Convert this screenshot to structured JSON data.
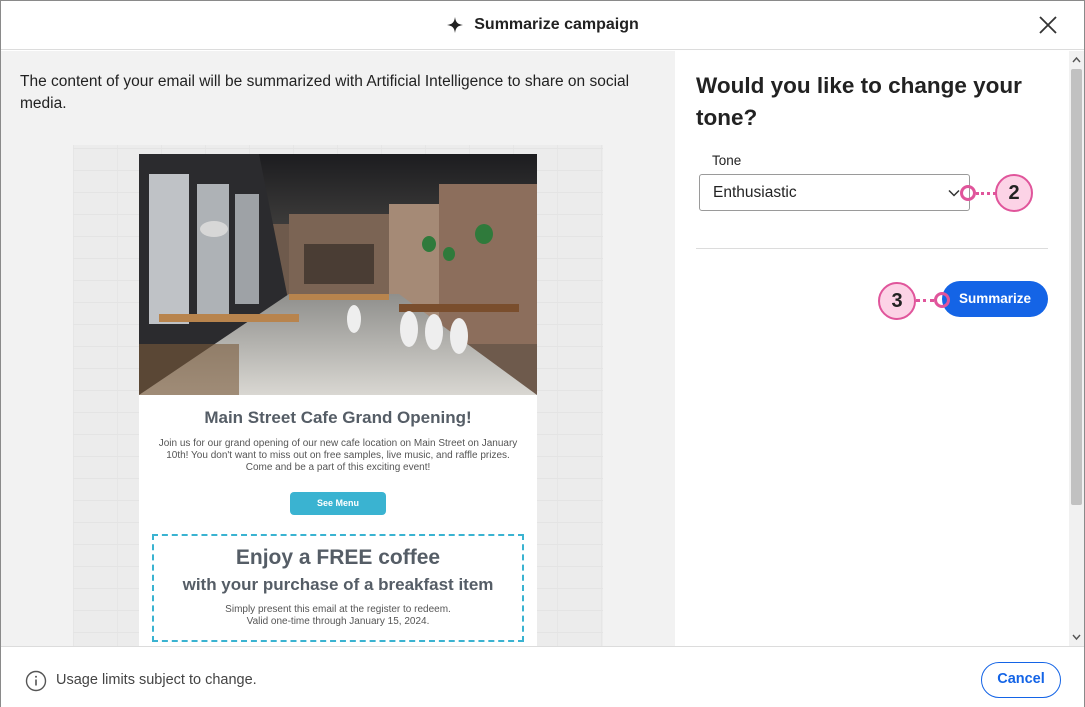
{
  "header": {
    "title": "Summarize campaign",
    "title_icon": "sparkle-icon",
    "close_icon": "close-icon"
  },
  "left": {
    "intro": "The content of your email will be summarized with Artificial Intelligence to share on social media."
  },
  "email": {
    "heading": "Main Street Cafe Grand Opening!",
    "body": "Join us for our grand opening of our new cafe location on Main Street on January 10th! You don't want to miss out on free samples, live music, and raffle prizes. Come and be a part of this exciting event!",
    "button_label": "See Menu",
    "coupon_title": "Enjoy a FREE coffee",
    "coupon_subtitle": "with your purchase of a breakfast item",
    "coupon_note_line1": "Simply present this email at the register to redeem.",
    "coupon_note_line2": "Valid one-time through January 15, 2024."
  },
  "right": {
    "question": "Would you like to change your tone?",
    "tone_label": "Tone",
    "tone_value": "Enthusiastic",
    "summarize_label": "Summarize"
  },
  "callouts": {
    "tone_step": "2",
    "summarize_step": "3"
  },
  "footer": {
    "note": "Usage limits subject to change.",
    "cancel_label": "Cancel"
  },
  "colors": {
    "primary": "#1464e6",
    "callout": "#e0559b",
    "callout_fill": "#fcd3e6",
    "email_accent": "#3ab3d1"
  }
}
